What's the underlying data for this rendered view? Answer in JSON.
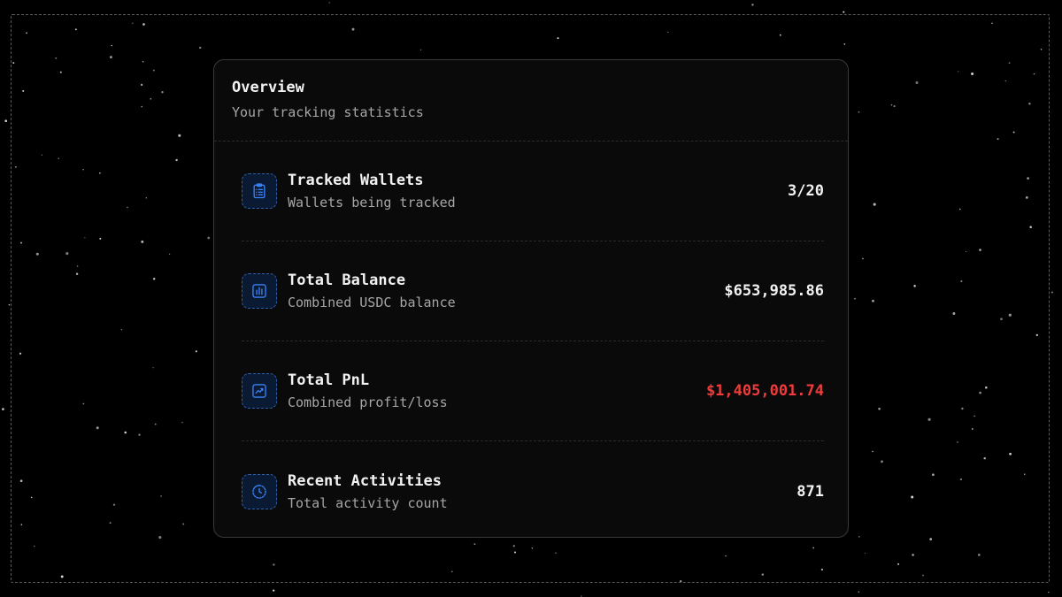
{
  "overview": {
    "title": "Overview",
    "subtitle": "Your tracking statistics"
  },
  "stats": [
    {
      "icon": "clipboard-list-icon",
      "label": "Tracked Wallets",
      "description": "Wallets being tracked",
      "value": "3/20",
      "value_color": "#f2f2f2"
    },
    {
      "icon": "bar-chart-icon",
      "label": "Total Balance",
      "description": "Combined USDC balance",
      "value": "$653,985.86",
      "value_color": "#f2f2f2"
    },
    {
      "icon": "trend-chart-icon",
      "label": "Total PnL",
      "description": "Combined profit/loss",
      "value": "$1,405,001.74",
      "value_color": "#ef3b3b"
    },
    {
      "icon": "clock-icon",
      "label": "Recent Activities",
      "description": "Total activity count",
      "value": "871",
      "value_color": "#f2f2f2"
    }
  ],
  "colors": {
    "background": "#000000",
    "card": "#0a0a0a",
    "accent_icon": "#3b82f6",
    "negative": "#ef3b3b"
  }
}
